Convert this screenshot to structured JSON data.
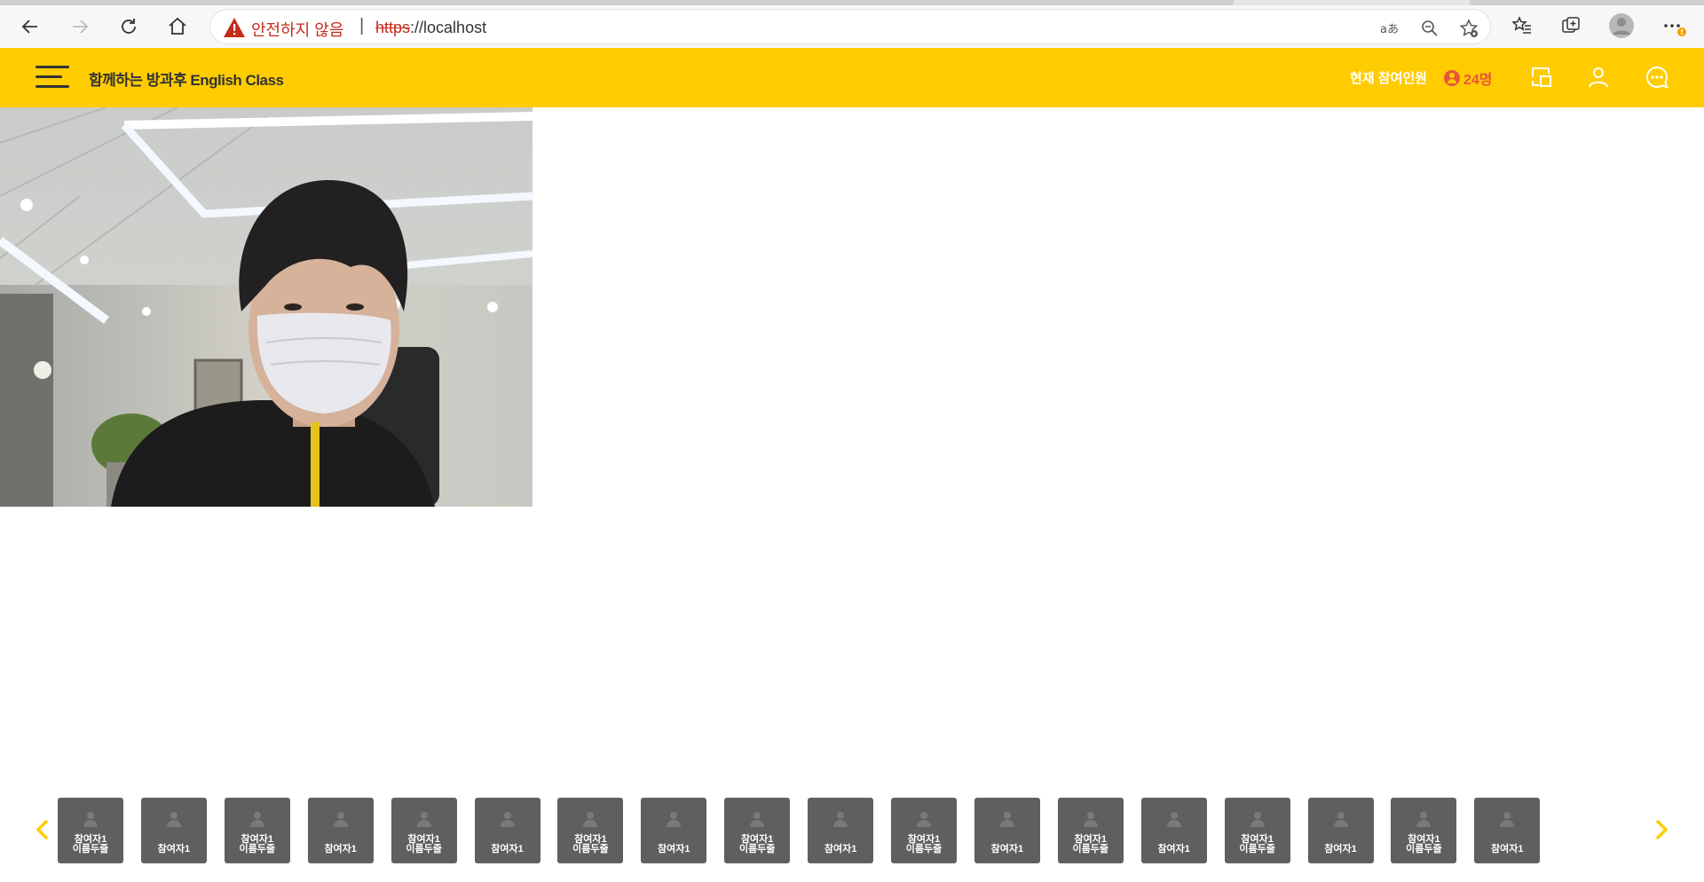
{
  "browser": {
    "security_warning": "안전하지 않음",
    "url_protocol": "https",
    "url_rest": "://localhost",
    "separator": "|"
  },
  "header": {
    "title": "함께하는 방과후 English Class",
    "participants_label": "현재 참여인원",
    "participants_count": "24명"
  },
  "participants": [
    {
      "line1": "참여자1",
      "line2": "이름두줄"
    },
    {
      "line1": "참여자1",
      "line2": ""
    },
    {
      "line1": "참여자1",
      "line2": "이름두줄"
    },
    {
      "line1": "참여자1",
      "line2": ""
    },
    {
      "line1": "참여자1",
      "line2": "이름두줄"
    },
    {
      "line1": "참여자1",
      "line2": ""
    },
    {
      "line1": "참여자1",
      "line2": "이름두줄"
    },
    {
      "line1": "참여자1",
      "line2": ""
    },
    {
      "line1": "참여자1",
      "line2": "이름두줄"
    },
    {
      "line1": "참여자1",
      "line2": ""
    },
    {
      "line1": "참여자1",
      "line2": "이름두줄"
    },
    {
      "line1": "참여자1",
      "line2": ""
    },
    {
      "line1": "참여자1",
      "line2": "이름두줄"
    },
    {
      "line1": "참여자1",
      "line2": ""
    },
    {
      "line1": "참여자1",
      "line2": "이름두줄"
    },
    {
      "line1": "참여자1",
      "line2": ""
    },
    {
      "line1": "참여자1",
      "line2": "이름두줄"
    },
    {
      "line1": "참여자1",
      "line2": ""
    }
  ],
  "colors": {
    "accent": "#ffcc00",
    "count": "#e8563a",
    "tile": "#5f5f5f",
    "warning": "#c42b1c"
  }
}
